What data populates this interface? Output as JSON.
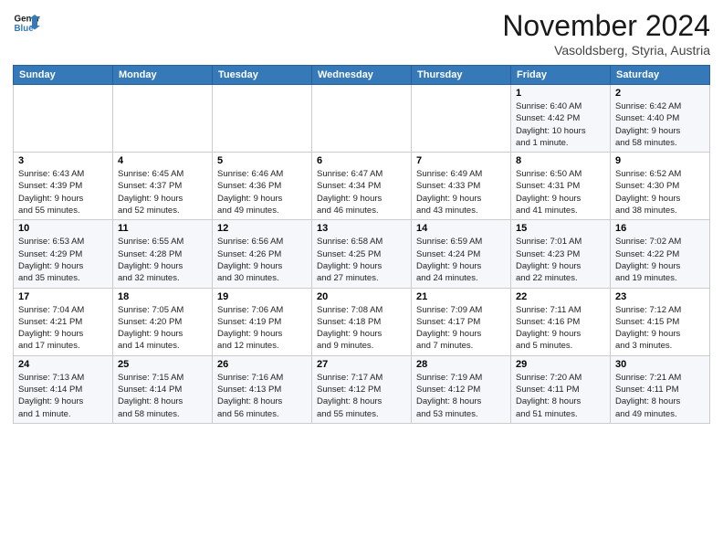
{
  "header": {
    "logo_line1": "General",
    "logo_line2": "Blue",
    "month": "November 2024",
    "location": "Vasoldsberg, Styria, Austria"
  },
  "weekdays": [
    "Sunday",
    "Monday",
    "Tuesday",
    "Wednesday",
    "Thursday",
    "Friday",
    "Saturday"
  ],
  "weeks": [
    [
      {
        "day": "",
        "info": ""
      },
      {
        "day": "",
        "info": ""
      },
      {
        "day": "",
        "info": ""
      },
      {
        "day": "",
        "info": ""
      },
      {
        "day": "",
        "info": ""
      },
      {
        "day": "1",
        "info": "Sunrise: 6:40 AM\nSunset: 4:42 PM\nDaylight: 10 hours\nand 1 minute."
      },
      {
        "day": "2",
        "info": "Sunrise: 6:42 AM\nSunset: 4:40 PM\nDaylight: 9 hours\nand 58 minutes."
      }
    ],
    [
      {
        "day": "3",
        "info": "Sunrise: 6:43 AM\nSunset: 4:39 PM\nDaylight: 9 hours\nand 55 minutes."
      },
      {
        "day": "4",
        "info": "Sunrise: 6:45 AM\nSunset: 4:37 PM\nDaylight: 9 hours\nand 52 minutes."
      },
      {
        "day": "5",
        "info": "Sunrise: 6:46 AM\nSunset: 4:36 PM\nDaylight: 9 hours\nand 49 minutes."
      },
      {
        "day": "6",
        "info": "Sunrise: 6:47 AM\nSunset: 4:34 PM\nDaylight: 9 hours\nand 46 minutes."
      },
      {
        "day": "7",
        "info": "Sunrise: 6:49 AM\nSunset: 4:33 PM\nDaylight: 9 hours\nand 43 minutes."
      },
      {
        "day": "8",
        "info": "Sunrise: 6:50 AM\nSunset: 4:31 PM\nDaylight: 9 hours\nand 41 minutes."
      },
      {
        "day": "9",
        "info": "Sunrise: 6:52 AM\nSunset: 4:30 PM\nDaylight: 9 hours\nand 38 minutes."
      }
    ],
    [
      {
        "day": "10",
        "info": "Sunrise: 6:53 AM\nSunset: 4:29 PM\nDaylight: 9 hours\nand 35 minutes."
      },
      {
        "day": "11",
        "info": "Sunrise: 6:55 AM\nSunset: 4:28 PM\nDaylight: 9 hours\nand 32 minutes."
      },
      {
        "day": "12",
        "info": "Sunrise: 6:56 AM\nSunset: 4:26 PM\nDaylight: 9 hours\nand 30 minutes."
      },
      {
        "day": "13",
        "info": "Sunrise: 6:58 AM\nSunset: 4:25 PM\nDaylight: 9 hours\nand 27 minutes."
      },
      {
        "day": "14",
        "info": "Sunrise: 6:59 AM\nSunset: 4:24 PM\nDaylight: 9 hours\nand 24 minutes."
      },
      {
        "day": "15",
        "info": "Sunrise: 7:01 AM\nSunset: 4:23 PM\nDaylight: 9 hours\nand 22 minutes."
      },
      {
        "day": "16",
        "info": "Sunrise: 7:02 AM\nSunset: 4:22 PM\nDaylight: 9 hours\nand 19 minutes."
      }
    ],
    [
      {
        "day": "17",
        "info": "Sunrise: 7:04 AM\nSunset: 4:21 PM\nDaylight: 9 hours\nand 17 minutes."
      },
      {
        "day": "18",
        "info": "Sunrise: 7:05 AM\nSunset: 4:20 PM\nDaylight: 9 hours\nand 14 minutes."
      },
      {
        "day": "19",
        "info": "Sunrise: 7:06 AM\nSunset: 4:19 PM\nDaylight: 9 hours\nand 12 minutes."
      },
      {
        "day": "20",
        "info": "Sunrise: 7:08 AM\nSunset: 4:18 PM\nDaylight: 9 hours\nand 9 minutes."
      },
      {
        "day": "21",
        "info": "Sunrise: 7:09 AM\nSunset: 4:17 PM\nDaylight: 9 hours\nand 7 minutes."
      },
      {
        "day": "22",
        "info": "Sunrise: 7:11 AM\nSunset: 4:16 PM\nDaylight: 9 hours\nand 5 minutes."
      },
      {
        "day": "23",
        "info": "Sunrise: 7:12 AM\nSunset: 4:15 PM\nDaylight: 9 hours\nand 3 minutes."
      }
    ],
    [
      {
        "day": "24",
        "info": "Sunrise: 7:13 AM\nSunset: 4:14 PM\nDaylight: 9 hours\nand 1 minute."
      },
      {
        "day": "25",
        "info": "Sunrise: 7:15 AM\nSunset: 4:14 PM\nDaylight: 8 hours\nand 58 minutes."
      },
      {
        "day": "26",
        "info": "Sunrise: 7:16 AM\nSunset: 4:13 PM\nDaylight: 8 hours\nand 56 minutes."
      },
      {
        "day": "27",
        "info": "Sunrise: 7:17 AM\nSunset: 4:12 PM\nDaylight: 8 hours\nand 55 minutes."
      },
      {
        "day": "28",
        "info": "Sunrise: 7:19 AM\nSunset: 4:12 PM\nDaylight: 8 hours\nand 53 minutes."
      },
      {
        "day": "29",
        "info": "Sunrise: 7:20 AM\nSunset: 4:11 PM\nDaylight: 8 hours\nand 51 minutes."
      },
      {
        "day": "30",
        "info": "Sunrise: 7:21 AM\nSunset: 4:11 PM\nDaylight: 8 hours\nand 49 minutes."
      }
    ]
  ]
}
